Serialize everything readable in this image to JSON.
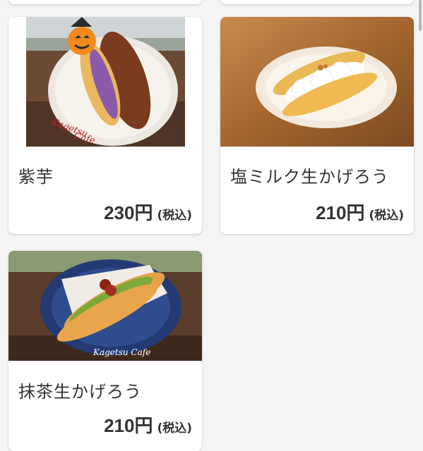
{
  "products": [
    {
      "name": "紫芋",
      "price": "230円",
      "tax_note": "(税込)",
      "image_icon": "murasaki-imo-eclair-photo"
    },
    {
      "name": "塩ミルク生かげろう",
      "price": "210円",
      "tax_note": "(税込)",
      "image_icon": "shio-milk-kagerou-photo"
    },
    {
      "name": "抹茶生かげろう",
      "price": "210円",
      "tax_note": "(税込)",
      "image_icon": "matcha-kagerou-photo"
    }
  ],
  "colors": {
    "background": "#f4f4f4",
    "card": "#ffffff",
    "text": "#333333"
  }
}
